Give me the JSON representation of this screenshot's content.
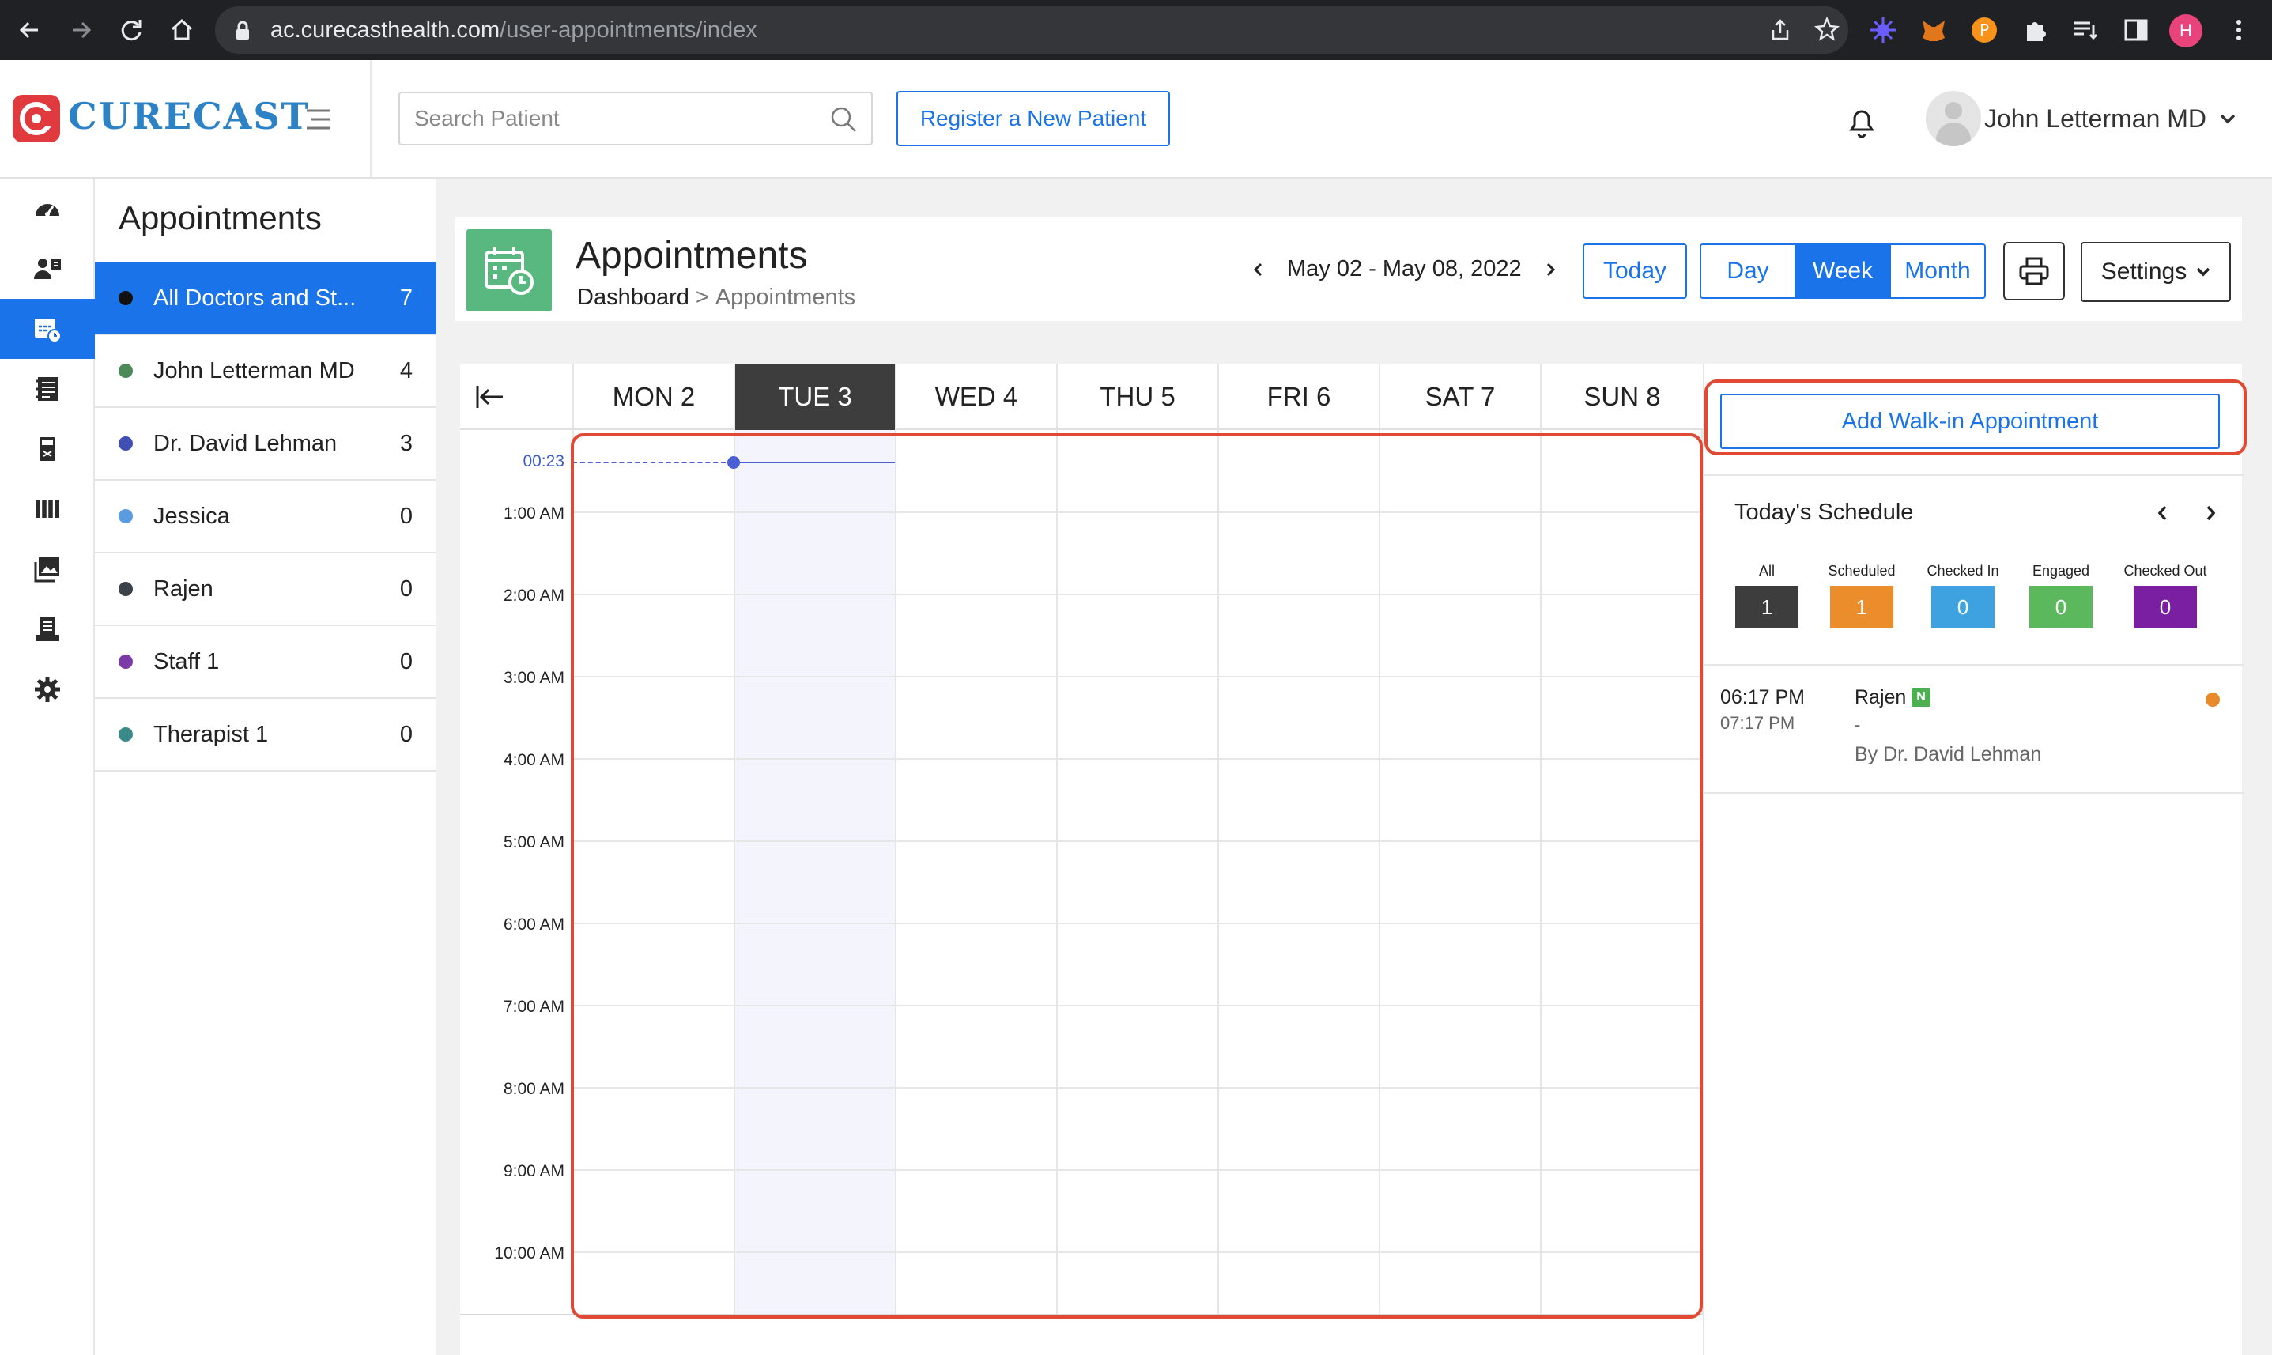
{
  "browser": {
    "url_host": "ac.curecasthealth.com",
    "url_path": "/user-appointments/index",
    "profile_initial": "H"
  },
  "header": {
    "logo_text": "CURECAST",
    "search_placeholder": "Search Patient",
    "register_label": "Register a New Patient",
    "user_name": "John Letterman MD"
  },
  "sidebar": {
    "title": "Appointments",
    "items": [
      {
        "label": "All Doctors and St...",
        "count": "7",
        "color": "#111111"
      },
      {
        "label": "John Letterman MD",
        "count": "4",
        "color": "#4c8a5a"
      },
      {
        "label": "Dr. David Lehman",
        "count": "3",
        "color": "#3f4fb3"
      },
      {
        "label": "Jessica",
        "count": "0",
        "color": "#5b9be0"
      },
      {
        "label": "Rajen",
        "count": "0",
        "color": "#3b4148"
      },
      {
        "label": "Staff 1",
        "count": "0",
        "color": "#7b3aa8"
      },
      {
        "label": "Therapist 1",
        "count": "0",
        "color": "#3b8a8a"
      }
    ]
  },
  "page": {
    "title": "Appointments",
    "breadcrumb_home": "Dashboard",
    "breadcrumb_sep": ">",
    "breadcrumb_current": "Appointments",
    "date_range": "May 02 - May 08, 2022",
    "today_label": "Today",
    "view_day": "Day",
    "view_week": "Week",
    "view_month": "Month",
    "view_selected": "Week",
    "settings_label": "Settings"
  },
  "calendar": {
    "days": [
      "MON 2",
      "TUE 3",
      "WED 4",
      "THU 5",
      "FRI 6",
      "SAT 7",
      "SUN 8"
    ],
    "today": "TUE 3",
    "now_label": "00:23",
    "times": [
      "1:00 AM",
      "2:00 AM",
      "3:00 AM",
      "4:00 AM",
      "5:00 AM",
      "6:00 AM",
      "7:00 AM",
      "8:00 AM",
      "9:00 AM",
      "10:00 AM"
    ]
  },
  "right_panel": {
    "walkin_label": "Add Walk-in Appointment",
    "schedule_title": "Today's Schedule",
    "stats": [
      {
        "label": "All",
        "value": "1",
        "color": "#3d3d3d"
      },
      {
        "label": "Scheduled",
        "value": "1",
        "color": "#ec8d2b"
      },
      {
        "label": "Checked In",
        "value": "0",
        "color": "#3ea2e0"
      },
      {
        "label": "Engaged",
        "value": "0",
        "color": "#5cb85c"
      },
      {
        "label": "Checked Out",
        "value": "0",
        "color": "#7b1fa2"
      }
    ],
    "appointment": {
      "start": "06:17 PM",
      "end": "07:17 PM",
      "patient": "Rajen",
      "badge": "N",
      "dash": "-",
      "by": "By Dr. David Lehman",
      "status_color": "#e8892a"
    }
  },
  "colors": {
    "accent": "#1a73e8",
    "highlight_border": "#e04a34",
    "logo_red": "#e03a3e",
    "calendar_icon_green": "#59b87f"
  }
}
